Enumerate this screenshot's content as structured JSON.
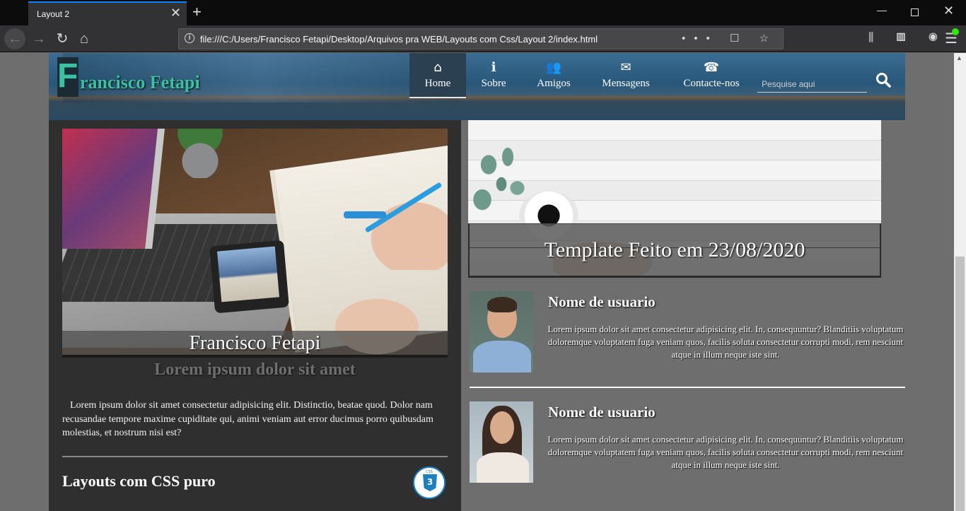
{
  "browser": {
    "tab_title": "Layout 2",
    "tab_close": "✕",
    "new_tab": "+",
    "url": "file:///C:/Users/Francisco Fetapi/Desktop/Arquivos pra WEB/Layouts com Css/Layout 2/index.html",
    "url_icons": "••• ☐ ☆",
    "tool_icons": "⫼ ▥ ◉",
    "window_controls": {
      "minimize": "—",
      "close": "✕"
    }
  },
  "header": {
    "logo_letter": "F",
    "logo_rest": "rancisco Fetapi",
    "menu": [
      {
        "label": "Home",
        "icon": "home-icon",
        "glyph": "⌂",
        "active": true
      },
      {
        "label": "Sobre",
        "icon": "info-icon",
        "glyph": "ℹ",
        "active": false
      },
      {
        "label": "Amigos",
        "icon": "users-icon",
        "glyph": "👥",
        "active": false
      },
      {
        "label": "Mensagens",
        "icon": "envelope-icon",
        "glyph": "✉",
        "active": false
      },
      {
        "label": "Contacte-nos",
        "icon": "phone-icon",
        "glyph": "☎",
        "active": false
      }
    ],
    "search_placeholder": "Pesquise aqui"
  },
  "left": {
    "hero_caption": "Francisco Fetapi",
    "title": "Lorem ipsum dolor sit amet",
    "body": "Lorem ipsum dolor sit amet consectetur adipisicing elit. Distinctio, beatae quod. Dolor nam recusandae tempore maxime cupiditate qui, animi veniam aut error ducimus porro quibusdam molestias, et nostrum nisi est?",
    "footer_title": "Layouts com CSS puro",
    "badge_text": "CSS",
    "badge_number": "3"
  },
  "banner": {
    "caption": "Template Feito em 23/08/2020"
  },
  "users": [
    {
      "name": "Nome de usuario",
      "bio": "Lorem ipsum dolor sit amet consectetur adipisicing elit. In, consequuntur? Blanditiis voluptatum doloremque voluptatem fuga veniam quos, facilis soluta consectetur corrupti modi, rem nesciunt atque in illum neque iste sint."
    },
    {
      "name": "Nome de usuario",
      "bio": "Lorem ipsum dolor sit amet consectetur adipisicing elit. In, consequuntur? Blanditiis voluptatum doloremque voluptatem fuga veniam quos, facilis soluta consectetur corrupti modi, rem nesciunt atque in illum neque iste sint."
    }
  ],
  "colors": {
    "accent": "#39c1a0",
    "page_bg": "#6e6e6e",
    "card_bg": "#2f2f2f",
    "browser_accent": "#0a84ff"
  }
}
